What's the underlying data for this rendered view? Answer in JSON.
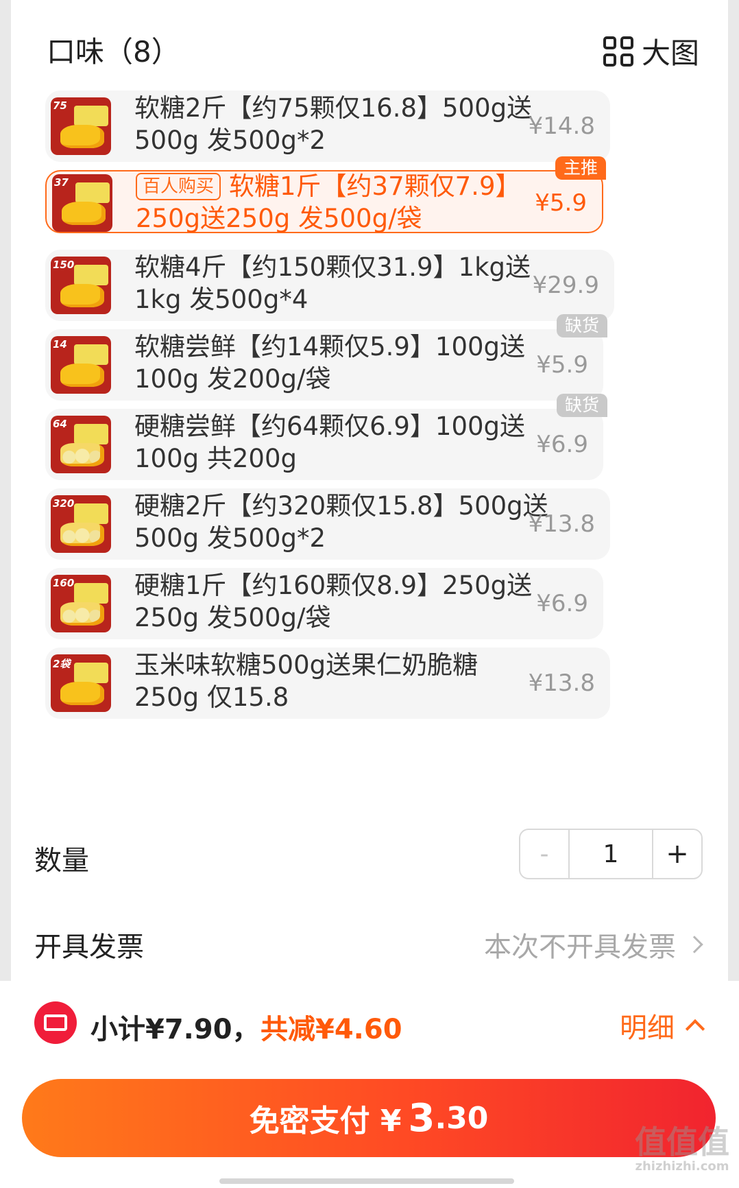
{
  "header": {
    "title": "口味（8）",
    "view_label": "大图",
    "view_icon": "grid-icon"
  },
  "options": [
    {
      "tag": "75",
      "line1": "软糖2斤【约75颗仅16.8】500g送",
      "line2": "500g 发500g*2",
      "price": "¥14.8",
      "kind": "soft"
    },
    {
      "tag": "37",
      "badge": "百人购买",
      "line1": "软糖1斤【约37颗仅7.9】",
      "line2": "250g送250g 发500g/袋",
      "price": "¥5.9",
      "corner": "主推",
      "selected": true,
      "kind": "soft"
    },
    {
      "tag": "150",
      "line1": "软糖4斤【约150颗仅31.9】1kg送",
      "line2": "1kg 发500g*4",
      "price": "¥29.9",
      "kind": "soft"
    },
    {
      "tag": "14",
      "line1": "软糖尝鲜【约14颗仅5.9】100g送",
      "line2": "100g 发200g/袋",
      "price": "¥5.9",
      "corner": "缺货",
      "kind": "soft"
    },
    {
      "tag": "64",
      "line1": "硬糖尝鲜【约64颗仅6.9】100g送",
      "line2": "100g 共200g",
      "price": "¥6.9",
      "corner": "缺货",
      "kind": "hard"
    },
    {
      "tag": "320",
      "line1": "硬糖2斤【约320颗仅15.8】500g送",
      "line2": "500g 发500g*2",
      "price": "¥13.8",
      "kind": "hard"
    },
    {
      "tag": "160",
      "line1": "硬糖1斤【约160颗仅8.9】250g送",
      "line2": "250g 发500g/袋",
      "price": "¥6.9",
      "kind": "hard"
    },
    {
      "tag": "2袋",
      "line1": "玉米味软糖500g送果仁奶脆糖",
      "line2": "250g 仅15.8",
      "price": "¥13.8",
      "kind": "soft"
    }
  ],
  "quantity": {
    "label": "数量",
    "minus": "-",
    "value": "1",
    "plus": "+"
  },
  "invoice": {
    "label": "开具发票",
    "value": "本次不开具发票"
  },
  "footer": {
    "subtotal": "小计¥7.90，",
    "discount": "共减¥4.60",
    "detail": "明细",
    "pay_label": "免密支付 ¥",
    "pay_amount_big": "3",
    "pay_amount_small": ".30"
  },
  "watermark": {
    "text": "值值值",
    "site": "zhizhizhi.com"
  },
  "colors": {
    "accent": "#ff6a1a",
    "price_selected": "#ff5a0a",
    "coupon": "#f01d3a"
  }
}
